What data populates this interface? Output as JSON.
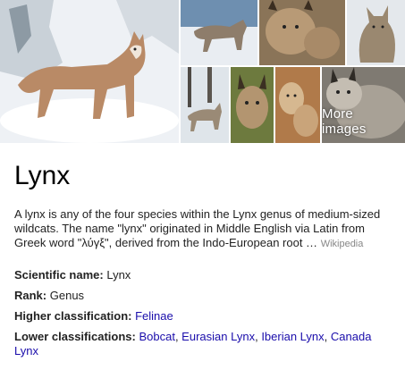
{
  "images": {
    "more_images_label": "More images"
  },
  "title": "Lynx",
  "description": {
    "text": "A lynx is any of the four species within the Lynx genus of medium-sized wildcats. The name \"lynx\" originated in Middle English via Latin from Greek word \"λύγξ\", derived from the Indo-European root …",
    "source_label": "Wikipedia"
  },
  "facts": {
    "scientific_name": {
      "label": "Scientific name:",
      "value": "Lynx"
    },
    "rank": {
      "label": "Rank:",
      "value": "Genus"
    },
    "higher_classification": {
      "label": "Higher classification:",
      "value": "Felinae"
    },
    "lower_classifications": {
      "label": "Lower classifications:",
      "items": [
        "Bobcat",
        "Eurasian Lynx",
        "Iberian Lynx",
        "Canada Lynx"
      ]
    }
  },
  "colors": {
    "link": "#1a0dab",
    "source": "#878787"
  }
}
